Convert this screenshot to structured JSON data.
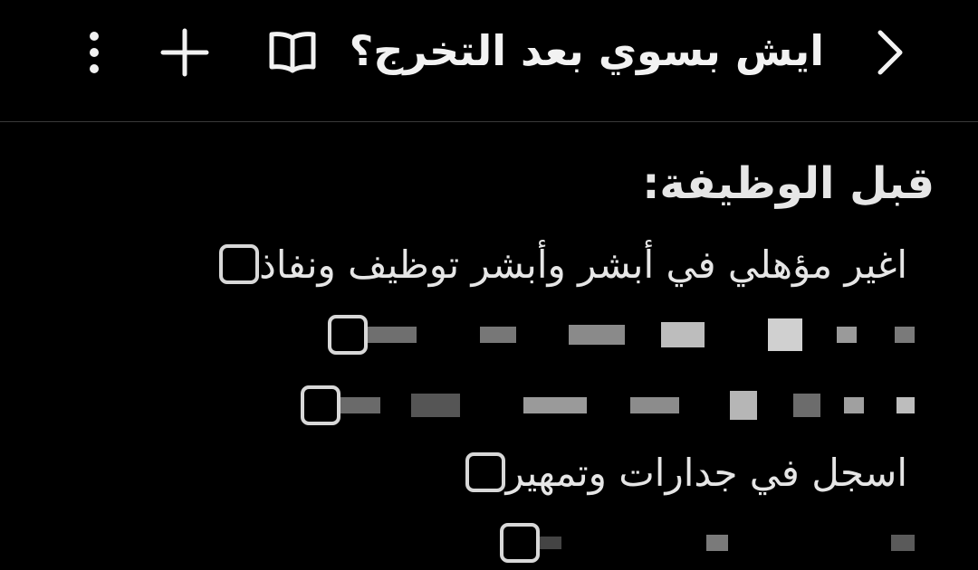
{
  "header": {
    "title": "ايش بسوي بعد التخرج؟",
    "icons": {
      "more": "more-vert-icon",
      "add": "plus-icon",
      "book": "book-open-icon",
      "forward": "chevron-right-icon"
    }
  },
  "note": {
    "heading": "قبل الوظيفة:",
    "items": [
      {
        "text": "اغير مؤهلي في أبشر وأبشر توظيف ونفاذ",
        "checked": false,
        "redacted": false
      },
      {
        "text": "",
        "checked": false,
        "redacted": true
      },
      {
        "text": "",
        "checked": false,
        "redacted": true
      },
      {
        "text": "اسجل في جدارات وتمهير",
        "checked": false,
        "redacted": false
      },
      {
        "text": "",
        "checked": false,
        "redacted": true
      }
    ]
  }
}
